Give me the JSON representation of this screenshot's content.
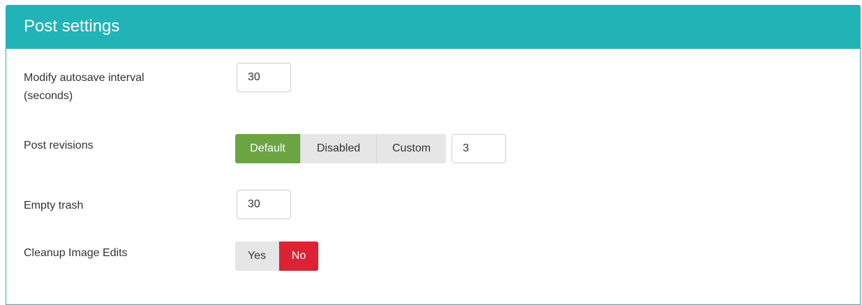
{
  "panel": {
    "title": "Post settings"
  },
  "colors": {
    "header": "#22b3b7",
    "active_green": "#6ca443",
    "active_red": "#dd2233",
    "inactive_segment": "#e6e6e6"
  },
  "autosave": {
    "label_line1": "Modify autosave interval",
    "label_line2": "(seconds)",
    "value": "30"
  },
  "revisions": {
    "label": "Post revisions",
    "options": [
      "Default",
      "Disabled",
      "Custom"
    ],
    "selected": "Default",
    "custom_value": "3"
  },
  "trash": {
    "label": "Empty trash",
    "value": "30"
  },
  "cleanup": {
    "label": "Cleanup Image Edits",
    "options": [
      "Yes",
      "No"
    ],
    "selected": "No"
  }
}
